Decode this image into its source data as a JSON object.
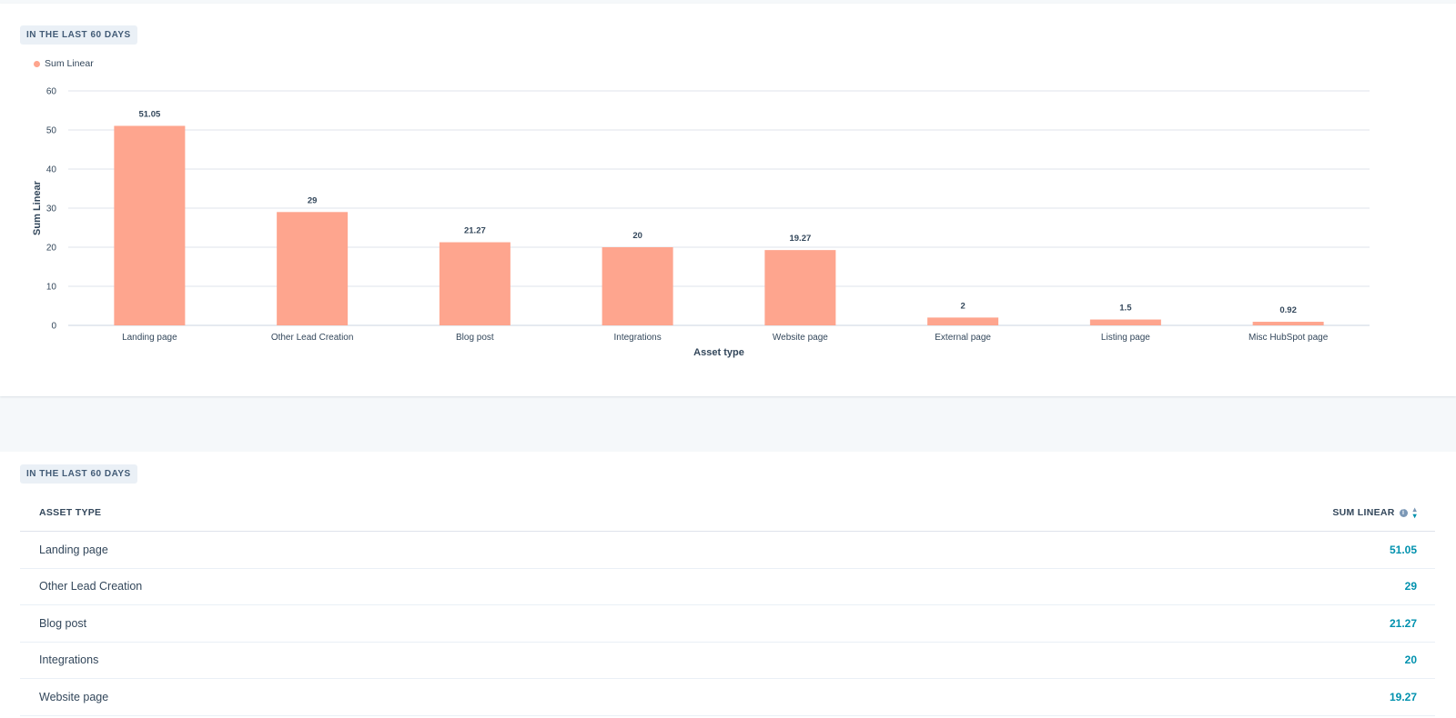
{
  "chart_card": {
    "date_range": "IN THE LAST 60 DAYS",
    "legend_label": "Sum Linear"
  },
  "chart_data": {
    "type": "bar",
    "categories": [
      "Landing page",
      "Other Lead Creation",
      "Blog post",
      "Integrations",
      "Website page",
      "External page",
      "Listing page",
      "Misc HubSpot page"
    ],
    "series": [
      {
        "name": "Sum Linear",
        "values": [
          51.05,
          29,
          21.27,
          20,
          19.27,
          2,
          1.5,
          0.92
        ]
      }
    ],
    "data_labels": [
      "51.05",
      "29",
      "21.27",
      "20",
      "19.27",
      "2",
      "1.5",
      "0.92"
    ],
    "xlabel": "Asset type",
    "ylabel": "Sum Linear",
    "ylim": [
      0,
      60
    ],
    "yticks": [
      0,
      10,
      20,
      30,
      40,
      50,
      60
    ],
    "grid": true,
    "legend_position": "top-left",
    "bar_color": "#fea58e"
  },
  "table_card": {
    "date_range": "IN THE LAST 60 DAYS",
    "columns": {
      "asset_type": "ASSET TYPE",
      "sum_linear": "SUM LINEAR"
    },
    "rows": [
      {
        "name": "Landing page",
        "value": "51.05"
      },
      {
        "name": "Other Lead Creation",
        "value": "29"
      },
      {
        "name": "Blog post",
        "value": "21.27"
      },
      {
        "name": "Integrations",
        "value": "20"
      },
      {
        "name": "Website page",
        "value": "19.27"
      }
    ]
  }
}
